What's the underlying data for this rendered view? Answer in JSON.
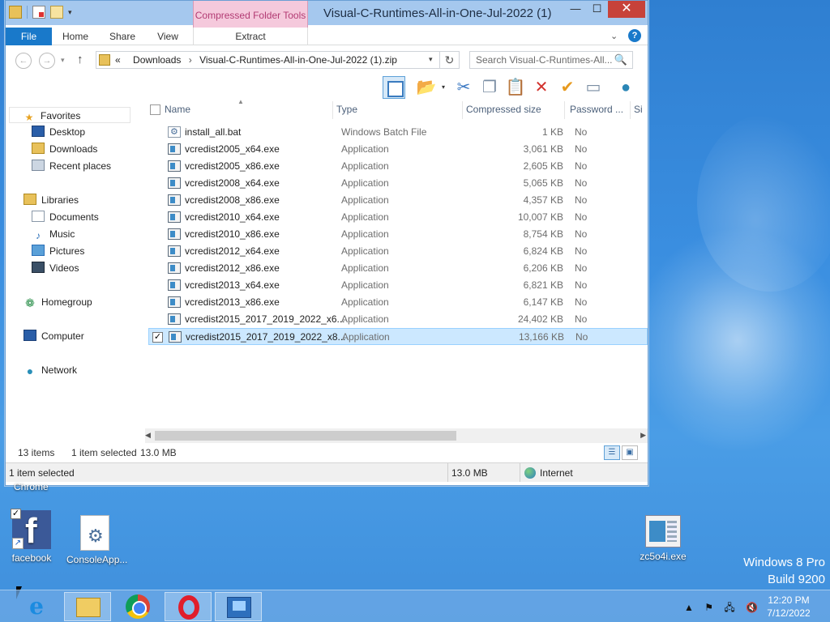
{
  "window": {
    "title": "Visual-C-Runtimes-All-in-One-Jul-2022 (1)",
    "context_tab": "Compressed Folder Tools",
    "controls": {
      "minimize": "—",
      "maximize": "☐",
      "close": "✕"
    }
  },
  "ribbon": {
    "tabs": {
      "file": "File",
      "home": "Home",
      "share": "Share",
      "view": "View",
      "extract": "Extract"
    },
    "collapse_glyph": "⌄",
    "help": "?"
  },
  "address": {
    "prefix": "«",
    "crumbs": [
      "Downloads",
      "Visual-C-Runtimes-All-in-One-Jul-2022 (1).zip"
    ],
    "search_placeholder": "Search Visual-C-Runtimes-All...",
    "refresh_glyph": "↻",
    "search_glyph": "🔍"
  },
  "toolbar_icons": [
    "preview-pane-icon",
    "folder-options-icon",
    "cut-icon",
    "copy-icon",
    "paste-icon",
    "delete-icon",
    "select-icon",
    "rename-icon",
    "globe-icon"
  ],
  "nav_pane": {
    "favorites": "Favorites",
    "favorites_items": [
      "Desktop",
      "Downloads",
      "Recent places"
    ],
    "libraries": "Libraries",
    "libraries_items": [
      "Documents",
      "Music",
      "Pictures",
      "Videos"
    ],
    "homegroup": "Homegroup",
    "computer": "Computer",
    "network": "Network"
  },
  "columns": {
    "name": "Name",
    "type": "Type",
    "compressed_size": "Compressed size",
    "password": "Password ...",
    "size": "Si"
  },
  "files": [
    {
      "name": "install_all.bat",
      "type": "Windows Batch File",
      "size": "1 KB",
      "password": "No",
      "kind": "bat",
      "selected": false
    },
    {
      "name": "vcredist2005_x64.exe",
      "type": "Application",
      "size": "3,061 KB",
      "password": "No",
      "kind": "exe",
      "selected": false
    },
    {
      "name": "vcredist2005_x86.exe",
      "type": "Application",
      "size": "2,605 KB",
      "password": "No",
      "kind": "exe",
      "selected": false
    },
    {
      "name": "vcredist2008_x64.exe",
      "type": "Application",
      "size": "5,065 KB",
      "password": "No",
      "kind": "exe",
      "selected": false
    },
    {
      "name": "vcredist2008_x86.exe",
      "type": "Application",
      "size": "4,357 KB",
      "password": "No",
      "kind": "exe",
      "selected": false
    },
    {
      "name": "vcredist2010_x64.exe",
      "type": "Application",
      "size": "10,007 KB",
      "password": "No",
      "kind": "exe",
      "selected": false
    },
    {
      "name": "vcredist2010_x86.exe",
      "type": "Application",
      "size": "8,754 KB",
      "password": "No",
      "kind": "exe",
      "selected": false
    },
    {
      "name": "vcredist2012_x64.exe",
      "type": "Application",
      "size": "6,824 KB",
      "password": "No",
      "kind": "exe",
      "selected": false
    },
    {
      "name": "vcredist2012_x86.exe",
      "type": "Application",
      "size": "6,206 KB",
      "password": "No",
      "kind": "exe",
      "selected": false
    },
    {
      "name": "vcredist2013_x64.exe",
      "type": "Application",
      "size": "6,821 KB",
      "password": "No",
      "kind": "exe",
      "selected": false
    },
    {
      "name": "vcredist2013_x86.exe",
      "type": "Application",
      "size": "6,147 KB",
      "password": "No",
      "kind": "exe",
      "selected": false
    },
    {
      "name": "vcredist2015_2017_2019_2022_x6...",
      "type": "Application",
      "size": "24,402 KB",
      "password": "No",
      "kind": "exe",
      "selected": false
    },
    {
      "name": "vcredist2015_2017_2019_2022_x8...",
      "type": "Application",
      "size": "13,166 KB",
      "password": "No",
      "kind": "exe",
      "selected": true
    }
  ],
  "status": {
    "items_count": "13 items",
    "selected": "1 item selected",
    "selected_size": "13.0 MB"
  },
  "bottom_status": {
    "selected": "1 item selected",
    "size": "13.0 MB",
    "zone": "Internet"
  },
  "desktop": {
    "chrome_label": "Chrome",
    "icons": [
      {
        "label": "facebook"
      },
      {
        "label": "ConsoleApp..."
      },
      {
        "label": "zc5o4i.exe"
      }
    ],
    "watermark_line1": "Windows 8 Pro",
    "watermark_line2": "Build 9200"
  },
  "taskbar": {
    "apps": [
      "internet-explorer",
      "file-explorer",
      "chrome",
      "opera",
      "network-app"
    ],
    "tray_icons": [
      "show-hidden-icons",
      "action-center-flag",
      "network-icon",
      "volume-muted-icon"
    ],
    "clock_time": "12:20 PM",
    "clock_date": "7/12/2022"
  },
  "colors": {
    "accent": "#1979ca",
    "selection": "#cce8ff",
    "context_tab": "#f5c9dc",
    "close_button": "#c7423a"
  }
}
